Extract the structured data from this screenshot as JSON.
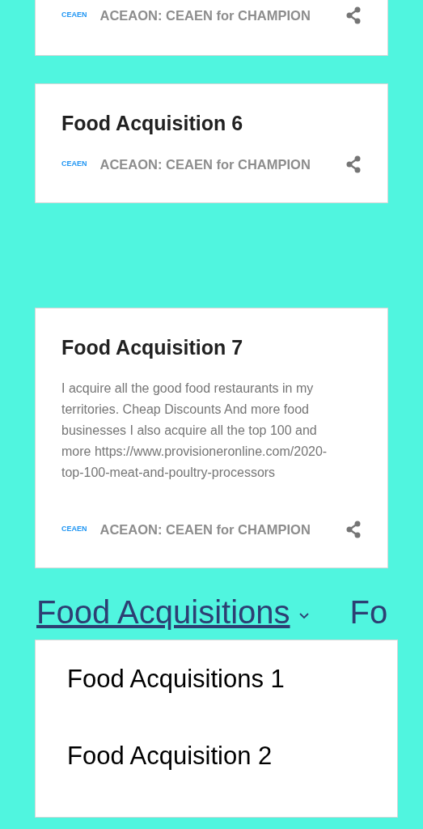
{
  "posts": [
    {
      "badge": "CEAEN",
      "author": "ACEAON: CEAEN for CHAMPION"
    },
    {
      "title": "Food Acquisition 6",
      "badge": "CEAEN",
      "author": "ACEAON: CEAEN for CHAMPION"
    },
    {
      "title": "Food Acquisition 7",
      "body": "I acquire all the good food restaurants in my territories. Cheap Discounts And more food businesses I also acquire all the top 100 and more https://www.provisioneronline.com/2020-top-100-meat-and-poultry-processors",
      "badge": "CEAEN",
      "author": "ACEAON: CEAEN for CHAMPION"
    }
  ],
  "nav": {
    "items": [
      {
        "label": "Food Acquisitions",
        "expanded": true
      },
      {
        "label": "Fo"
      }
    ],
    "dropdown": [
      "Food Acquisitions 1",
      "Food Acquisition 2"
    ]
  }
}
